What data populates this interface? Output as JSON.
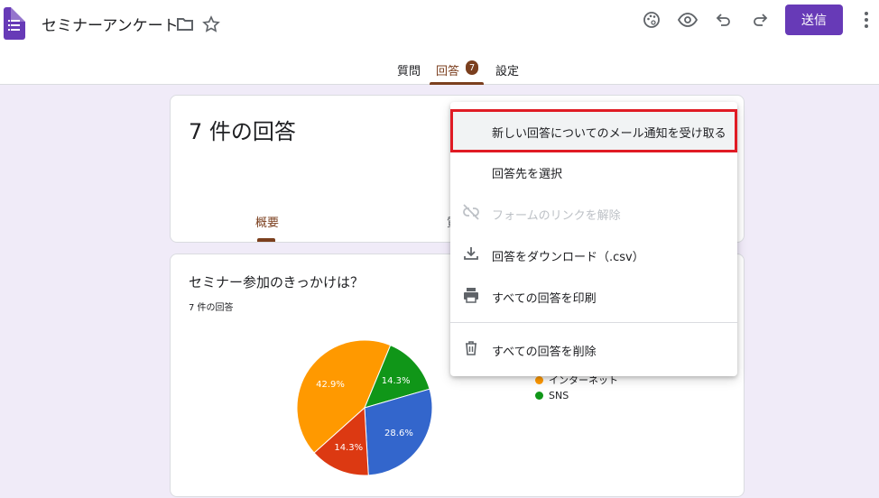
{
  "header": {
    "title": "セミナーアンケート",
    "send_label": "送信"
  },
  "tabs": [
    {
      "label": "質問"
    },
    {
      "label": "回答",
      "badge": "7"
    },
    {
      "label": "設定"
    }
  ],
  "summary": {
    "title": "7 件の回答",
    "tab_summary": "概要",
    "tab_partial": "質"
  },
  "question": {
    "title": "セミナー参加のきっかけは？",
    "count": "7 件の回答",
    "legend": [
      {
        "label": "インターネット",
        "color": "#ff9900"
      },
      {
        "label": "SNS",
        "color": "#109618"
      }
    ]
  },
  "chart_data": {
    "type": "pie",
    "slices": [
      {
        "value": 42.9,
        "label": "42.9%",
        "color": "#ff9900"
      },
      {
        "value": 14.3,
        "label": "14.3%",
        "color": "#109618"
      },
      {
        "value": 28.6,
        "label": "28.6%",
        "color": "#3366cc"
      },
      {
        "value": 14.3,
        "label": "14.3%",
        "color": "#dc3912"
      }
    ]
  },
  "menu": {
    "items": [
      {
        "label": "新しい回答についてのメール通知を受け取る",
        "icon": "none"
      },
      {
        "label": "回答先を選択",
        "icon": "none"
      },
      {
        "label": "フォームのリンクを解除",
        "icon": "link-off-icon",
        "disabled": true
      },
      {
        "label": "回答をダウンロード（.csv）",
        "icon": "download-icon"
      },
      {
        "label": "すべての回答を印刷",
        "icon": "print-icon"
      },
      {
        "label": "すべての回答を削除",
        "icon": "trash-icon"
      }
    ]
  }
}
